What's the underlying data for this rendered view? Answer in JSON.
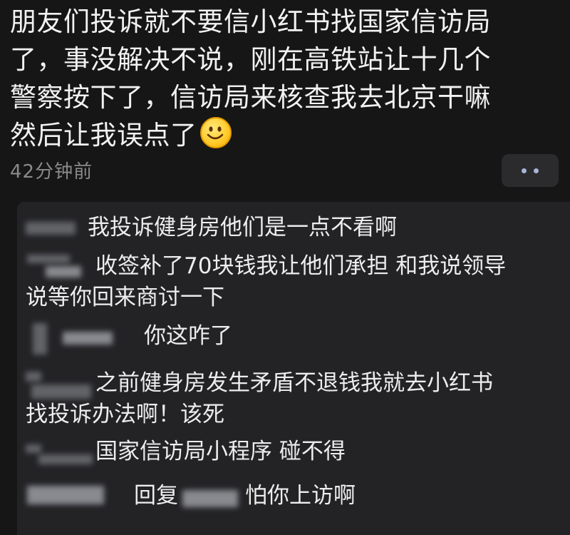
{
  "post": {
    "lines": [
      "朋友们投诉就不要信小红书找国家信访局",
      "了，事没解决不说，刚在高铁站让十几个",
      "警察按下了，信访局来核查我去北京干嘛",
      "然后让我误点了"
    ],
    "emoji": "smile-emoji"
  },
  "meta": {
    "timestamp": "42分钟前",
    "more_icon": "more-dots-icon",
    "accent": "#a8b4d8"
  },
  "comments": [
    {
      "lines": [
        "我投诉健身房他们是一点不看啊"
      ]
    },
    {
      "lines": [
        "收签补了70块钱我让他们承担 和我说领导",
        "说等你回来商讨一下"
      ]
    },
    {
      "lines": [
        "你这咋了"
      ]
    },
    {
      "lines": [
        "之前健身房发生矛盾不退钱我就去小红书",
        "找投诉办法啊！该死"
      ]
    },
    {
      "lines": [
        "国家信访局小程序 碰不得"
      ]
    },
    {
      "lines": [
        "回复",
        "怕你上访啊"
      ]
    }
  ]
}
